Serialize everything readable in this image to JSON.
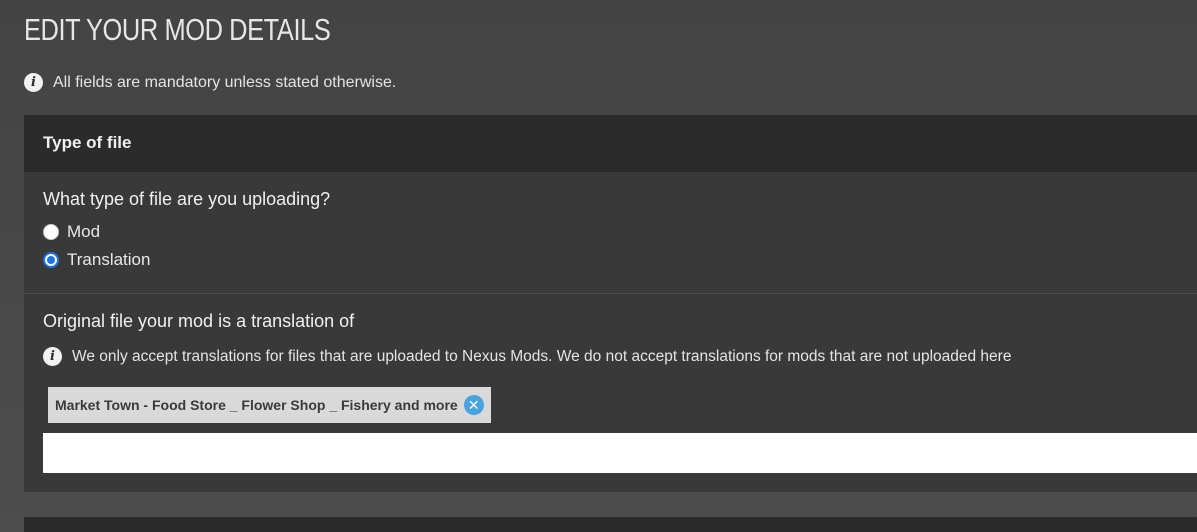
{
  "page": {
    "title": "EDIT YOUR MOD DETAILS",
    "mandatory_notice": "All fields are mandatory unless stated otherwise."
  },
  "section": {
    "header": "Type of file",
    "file_type_question": "What type of file are you uploading?",
    "file_type_options": [
      {
        "label": "Mod",
        "checked": false
      },
      {
        "label": "Translation",
        "checked": true
      }
    ],
    "original_file_question": "Original file your mod is a translation of",
    "original_file_info": "We only accept translations for files that are uploaded to Nexus Mods. We do not accept translations for mods that are not uploaded here",
    "selected_file": "Market Town - Food Store _ Flower Shop _ Fishery and more",
    "search_value": ""
  },
  "icons": {
    "info": "info-icon",
    "remove": "close-circle-icon"
  },
  "colors": {
    "accent": "#1a73e8",
    "remove_badge": "#4aa3df"
  }
}
